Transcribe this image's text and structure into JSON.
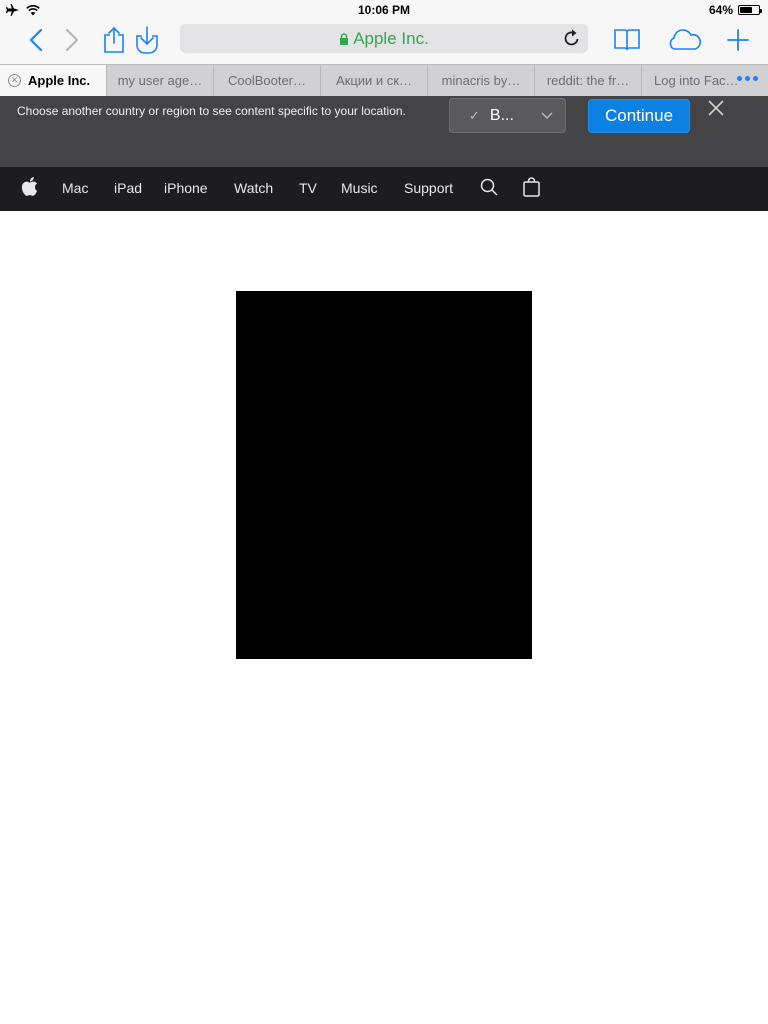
{
  "status_bar": {
    "time": "10:06 PM",
    "battery_percent": "64%",
    "battery_level": 0.64,
    "icons": [
      "airplane-icon",
      "wifi-icon",
      "battery-icon"
    ]
  },
  "toolbar": {
    "url": "Apple Inc.",
    "secure": true,
    "colors": {
      "accent": "#1a82fb",
      "url_green": "#2fa84f"
    },
    "icons": [
      "back-icon",
      "forward-icon",
      "share-icon",
      "download-icon",
      "reload-icon",
      "bookmarks-icon",
      "cloud-tabs-icon",
      "new-tab-icon"
    ]
  },
  "tabs": [
    {
      "label": "Apple Inc.",
      "active": true
    },
    {
      "label": "my user age…",
      "active": false
    },
    {
      "label": "CoolBooter…",
      "active": false
    },
    {
      "label": "Акции и ск…",
      "active": false
    },
    {
      "label": "minacris by…",
      "active": false
    },
    {
      "label": "reddit: the fr…",
      "active": false
    },
    {
      "label": "Log into Fac…",
      "active": false
    }
  ],
  "locale_banner": {
    "message": "Choose another country or region to see content specific to your location.",
    "select_value": "B...",
    "continue_label": "Continue",
    "colors": {
      "continue": "#0d81e2",
      "background": "#444446"
    }
  },
  "apple_nav": {
    "items": [
      "Mac",
      "iPad",
      "iPhone",
      "Watch",
      "TV",
      "Music",
      "Support"
    ],
    "icons": [
      "apple-logo-icon",
      "search-icon",
      "bag-icon"
    ]
  }
}
